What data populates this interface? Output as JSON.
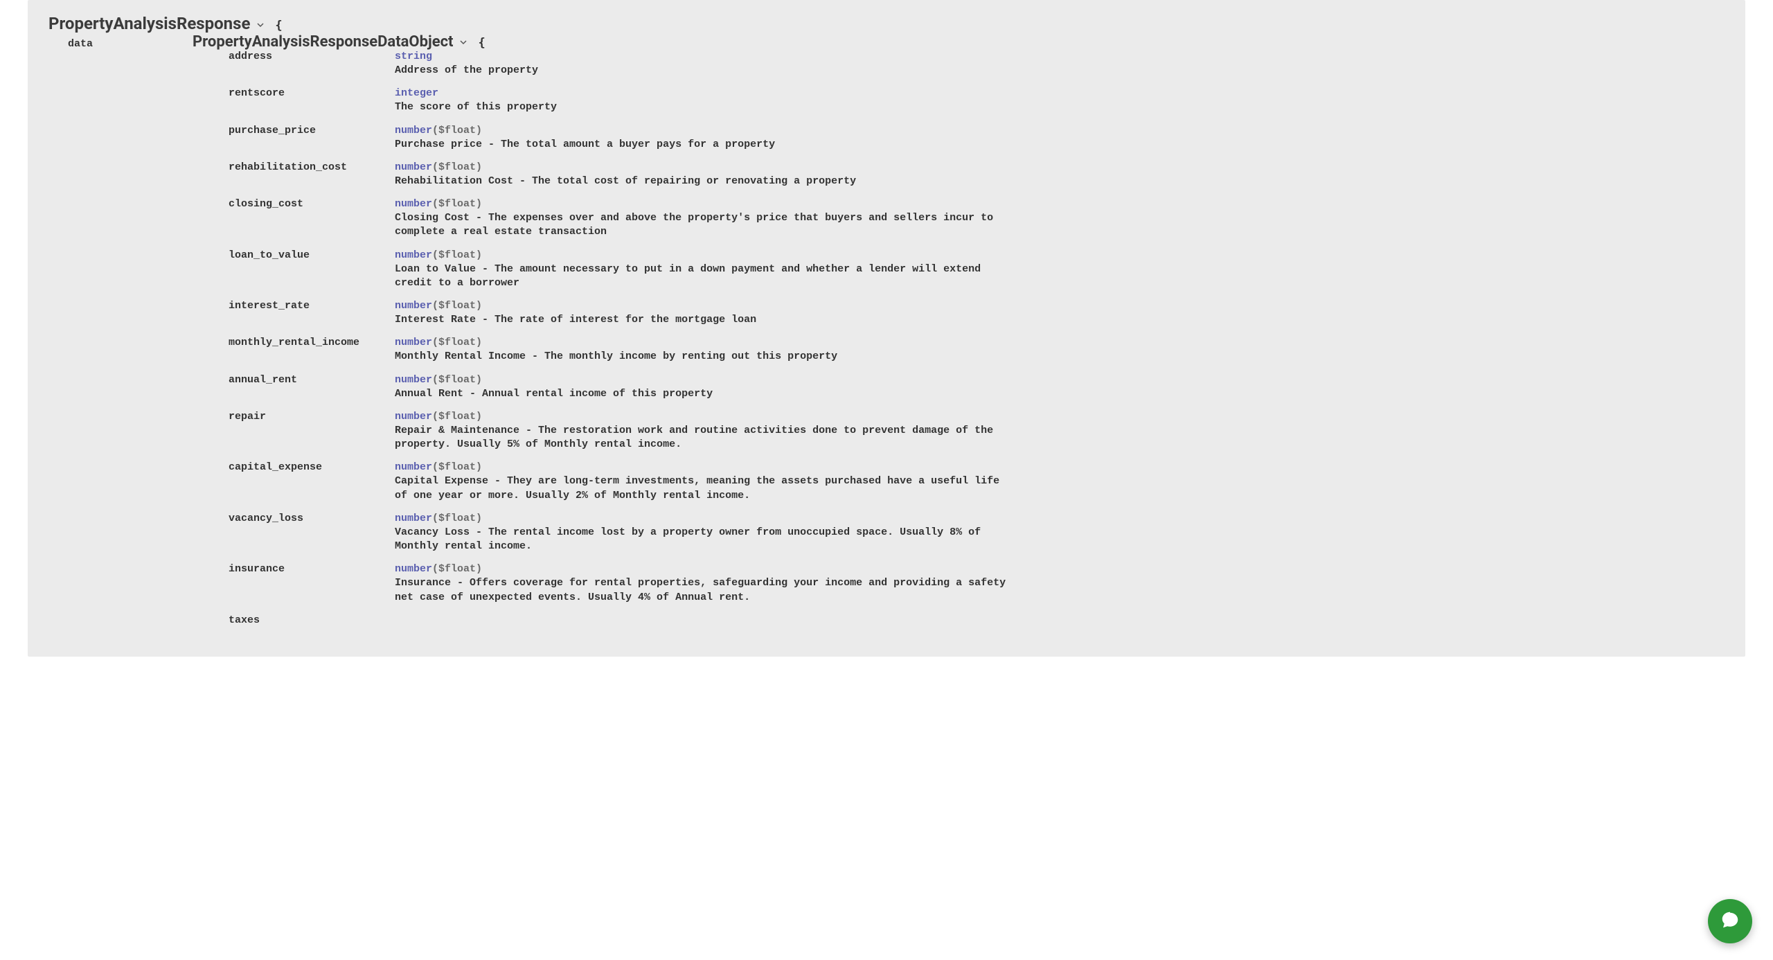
{
  "schema": {
    "root_model": "PropertyAnalysisResponse",
    "open_brace": "{",
    "data_key": "data",
    "nested_model": "PropertyAnalysisResponseDataObject",
    "nested_open_brace": "{",
    "properties": [
      {
        "name": "address",
        "type": "string",
        "format": "",
        "desc": "Address of the property"
      },
      {
        "name": "rentscore",
        "type": "integer",
        "format": "",
        "desc": "The score of this property"
      },
      {
        "name": "purchase_price",
        "type": "number",
        "format": "($float)",
        "desc": "Purchase price - The total amount a buyer pays for a property"
      },
      {
        "name": "rehabilitation_cost",
        "type": "number",
        "format": "($float)",
        "desc": "Rehabilitation Cost - The total cost of repairing or renovating a property"
      },
      {
        "name": "closing_cost",
        "type": "number",
        "format": "($float)",
        "desc": "Closing Cost - The expenses over and above the property's price that buyers and sellers incur to complete a real estate transaction"
      },
      {
        "name": "loan_to_value",
        "type": "number",
        "format": "($float)",
        "desc": "Loan to Value - The amount necessary to put in a down payment and whether a lender will extend credit to a borrower"
      },
      {
        "name": "interest_rate",
        "type": "number",
        "format": "($float)",
        "desc": "Interest Rate - The rate of interest for the mortgage loan"
      },
      {
        "name": "monthly_rental_income",
        "type": "number",
        "format": "($float)",
        "desc": "Monthly Rental Income - The monthly income by renting out this property"
      },
      {
        "name": "annual_rent",
        "type": "number",
        "format": "($float)",
        "desc": "Annual Rent - Annual rental income of this property"
      },
      {
        "name": "repair",
        "type": "number",
        "format": "($float)",
        "desc": "Repair & Maintenance - The restoration work and routine activities done to prevent damage of the property. Usually 5% of Monthly rental income."
      },
      {
        "name": "capital_expense",
        "type": "number",
        "format": "($float)",
        "desc": "Capital Expense - They are long-term investments, meaning the assets purchased have a useful life of one year or more. Usually 2% of Monthly rental income."
      },
      {
        "name": "vacancy_loss",
        "type": "number",
        "format": "($float)",
        "desc": "Vacancy Loss - The rental income lost by a property owner from unoccupied space. Usually 8% of Monthly rental income."
      },
      {
        "name": "insurance",
        "type": "number",
        "format": "($float)",
        "desc": "Insurance - Offers coverage for rental properties, safeguarding your income and providing a safety net case of unexpected events. Usually 4% of Annual rent."
      },
      {
        "name": "taxes",
        "type": "",
        "format": "",
        "desc": ""
      }
    ]
  }
}
